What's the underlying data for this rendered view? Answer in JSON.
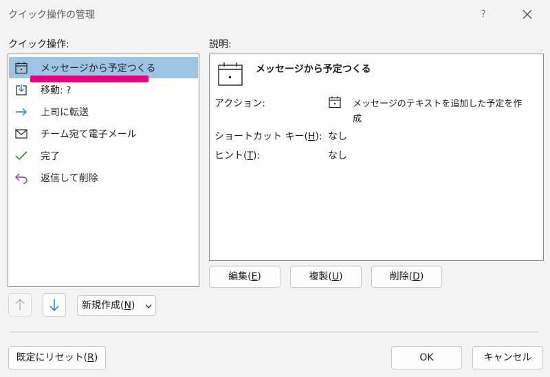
{
  "dialog": {
    "title": "クイック操作の管理",
    "help": "?",
    "accent": "#9ec4e4",
    "annotation_color": "#e6007e"
  },
  "left": {
    "label": "クイック操作:",
    "items": [
      {
        "label": "メッセージから予定つくる",
        "icon": "calendar-icon",
        "selected": true
      },
      {
        "label": "移動: ?",
        "icon": "move-to-folder-icon"
      },
      {
        "label": "上司に転送",
        "icon": "forward-arrow-icon"
      },
      {
        "label": "チーム宛て電子メール",
        "icon": "envelope-icon"
      },
      {
        "label": "完了",
        "icon": "checkmark-icon"
      },
      {
        "label": "返信して削除",
        "icon": "reply-delete-icon"
      }
    ],
    "new_button": {
      "prefix": "新規作成(",
      "key": "N",
      "suffix": ")"
    }
  },
  "right": {
    "label": "説明:",
    "name": "メッセージから予定つくる",
    "action_label": "アクション:",
    "action_text_line1": "メッセージのテキストを追加した予定を作",
    "action_text_line2": "成",
    "shortcut_label_prefix": "ショートカット キー(",
    "shortcut_label_key": "H",
    "shortcut_label_suffix": "):",
    "shortcut_value": "なし",
    "tip_label_prefix": "ヒント(",
    "tip_label_key": "T",
    "tip_label_suffix": "):",
    "tip_value": "なし",
    "edit": {
      "prefix": "編集(",
      "key": "E",
      "suffix": ")"
    },
    "duplicate": {
      "prefix": "複製(",
      "key": "U",
      "suffix": ")"
    },
    "delete": {
      "prefix": "削除(",
      "key": "D",
      "suffix": ")"
    }
  },
  "footer": {
    "reset": {
      "prefix": "既定にリセット(",
      "key": "R",
      "suffix": ")"
    },
    "ok": "OK",
    "cancel": "キャンセル"
  }
}
